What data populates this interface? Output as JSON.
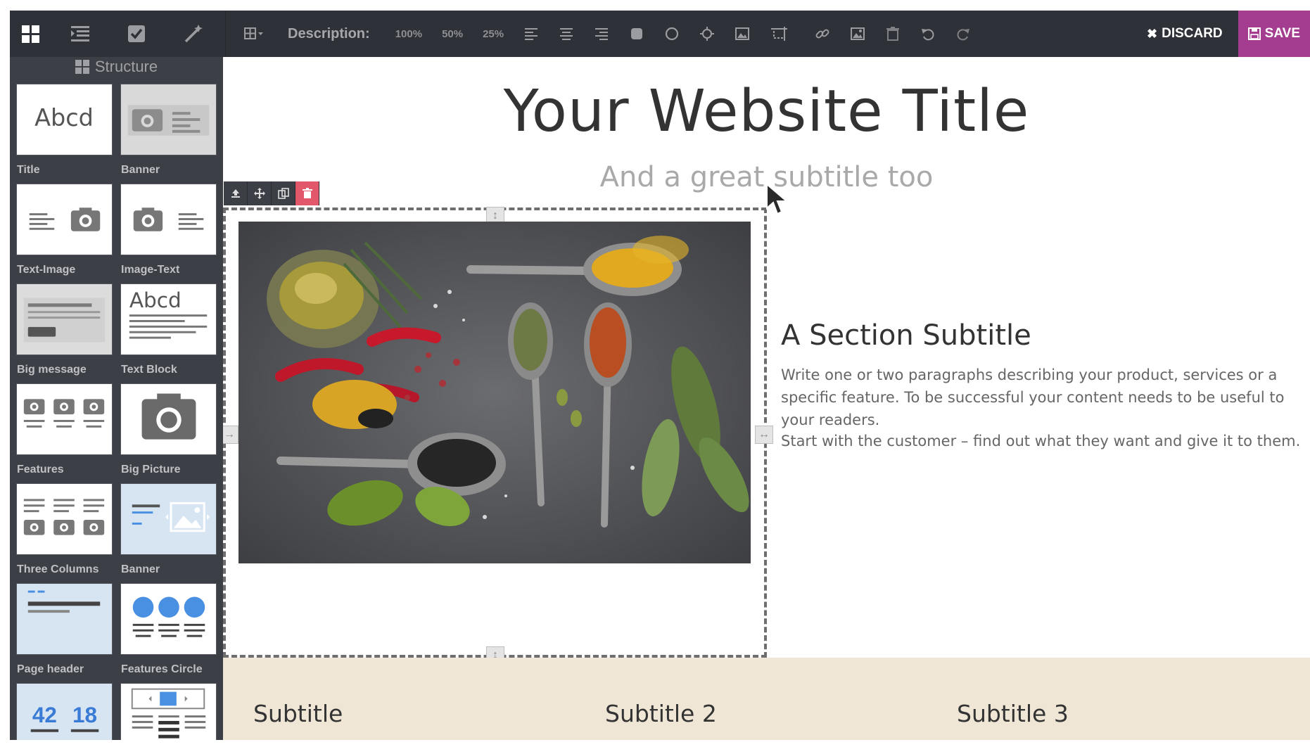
{
  "toolbar": {
    "description_label": "Description:",
    "size_options": [
      "100%",
      "50%",
      "25%"
    ],
    "discard_label": "DISCARD",
    "save_label": "SAVE",
    "save_color": "#a43c90"
  },
  "panel": {
    "title": "Structure",
    "snippets": [
      {
        "label": "Title",
        "thumb_text": "Abcd"
      },
      {
        "label": "Banner"
      },
      {
        "label": "Text-Image"
      },
      {
        "label": "Image-Text"
      },
      {
        "label": "Big message"
      },
      {
        "label": "Text Block",
        "thumb_text": "Abcd"
      },
      {
        "label": "Features"
      },
      {
        "label": "Big Picture"
      },
      {
        "label": "Three Columns"
      },
      {
        "label": "Banner"
      },
      {
        "label": "Page header"
      },
      {
        "label": "Features Circle"
      },
      {
        "label": "",
        "thumb_numbers": [
          "42",
          "18"
        ]
      },
      {
        "label": ""
      }
    ]
  },
  "page": {
    "title": "Your Website Title",
    "subtitle": "And a great subtitle too",
    "section_subtitle": "A Section Subtitle",
    "paragraph1": "Write one or two paragraphs describing your product, services or a specific feature. To be successful your content needs to be useful to your readers.",
    "paragraph2": "Start with the customer – find out what they want and give it to them.",
    "band_subtitles": [
      "Subtitle",
      "Subtitle 2",
      "Subtitle 3"
    ],
    "band_color": "#efe6d6"
  }
}
